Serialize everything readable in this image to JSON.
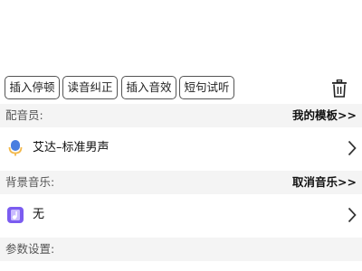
{
  "toolbar": {
    "insert_pause": "插入停顿",
    "pronunciation_fix": "读音纠正",
    "insert_sfx": "插入音效",
    "preview_sentence": "短句试听",
    "delete_icon": "trash-icon"
  },
  "voice_section": {
    "label": "配音员:",
    "action": "我的模板>>",
    "selected_voice": "艾达–标准男声",
    "icon": "microphone-icon"
  },
  "music_section": {
    "label": "背景音乐:",
    "action": "取消音乐>>",
    "selected_music": "无",
    "icon": "music-icon"
  },
  "params_section": {
    "label": "参数设置:"
  },
  "colors": {
    "accent_blue": "#4a7ee0",
    "music_purple": "#7b5cf0",
    "header_bg": "#f4f4f4"
  }
}
